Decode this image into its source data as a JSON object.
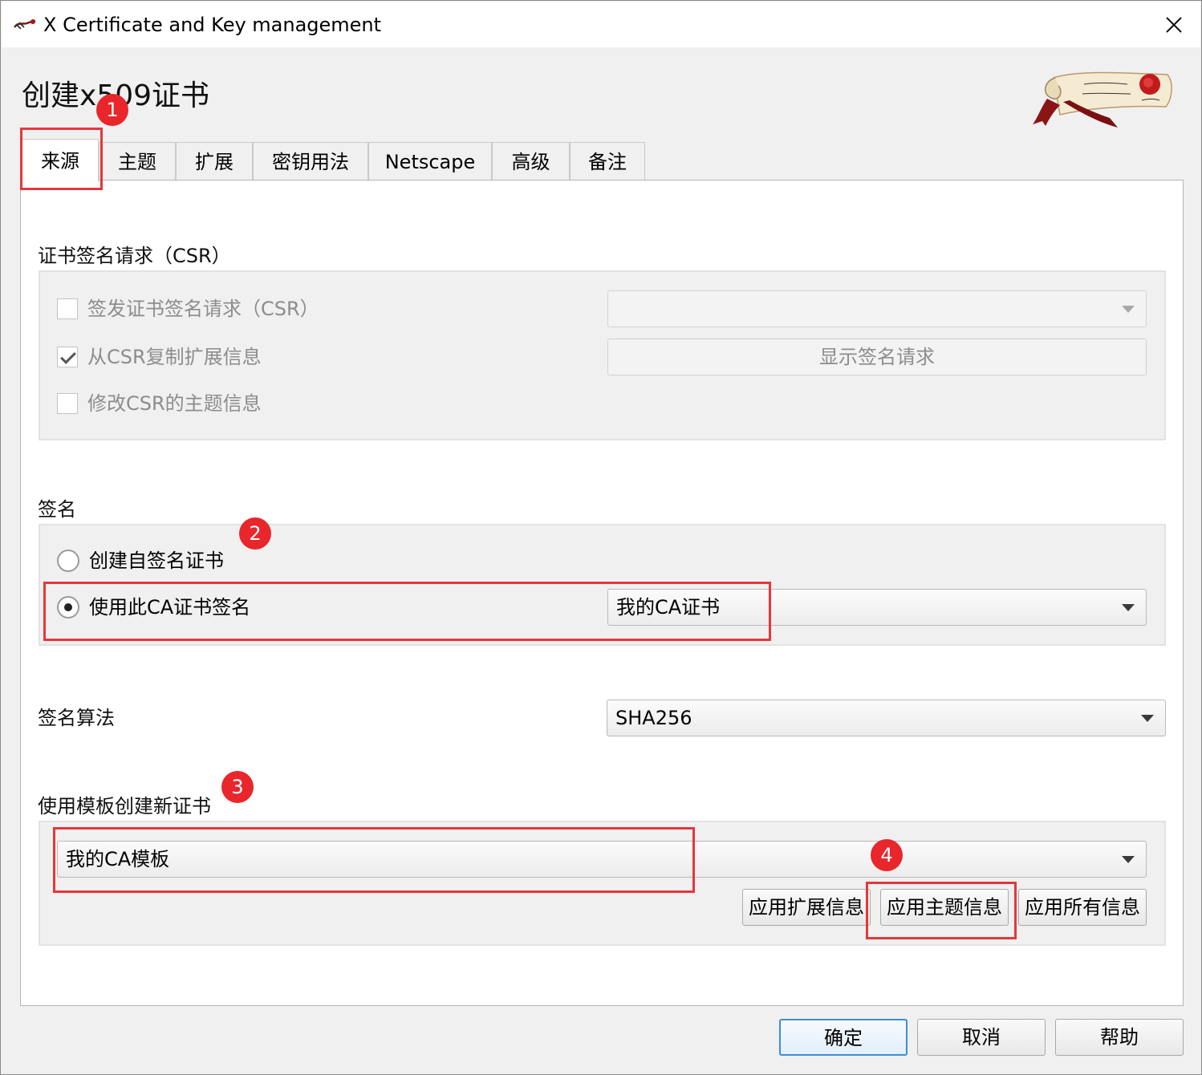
{
  "window": {
    "title": "X Certificate and Key management",
    "icon": "xca-icon",
    "close_icon": "close-icon"
  },
  "page": {
    "title": "创建x509证书",
    "logo": "scroll-rose-logo"
  },
  "tabs": [
    {
      "label": "来源",
      "active": true
    },
    {
      "label": "主题",
      "active": false
    },
    {
      "label": "扩展",
      "active": false
    },
    {
      "label": "密钥用法",
      "active": false
    },
    {
      "label": "Netscape",
      "active": false
    },
    {
      "label": "高级",
      "active": false
    },
    {
      "label": "备注",
      "active": false
    }
  ],
  "csr": {
    "label": "证书签名请求（CSR）",
    "sign_csr": {
      "label": "签发证书签名请求（CSR）",
      "checked": false,
      "enabled": false
    },
    "copy_ext": {
      "label": "从CSR复制扩展信息",
      "checked": true,
      "enabled": false
    },
    "modify_subject": {
      "label": "修改CSR的主题信息",
      "checked": false,
      "enabled": false
    },
    "csr_select_value": "",
    "show_request_button": "显示签名请求"
  },
  "signing": {
    "label": "签名",
    "self_signed": {
      "label": "创建自签名证书",
      "selected": false
    },
    "use_ca": {
      "label": "使用此CA证书签名",
      "selected": true
    },
    "ca_select_value": "我的CA证书"
  },
  "algorithm": {
    "label": "签名算法",
    "value": "SHA256"
  },
  "template": {
    "label": "使用模板创建新证书",
    "value": "我的CA模板",
    "apply_ext_button": "应用扩展信息",
    "apply_subject_button": "应用主题信息",
    "apply_all_button": "应用所有信息"
  },
  "footer": {
    "ok_button": "确定",
    "cancel_button": "取消",
    "help_button": "帮助"
  },
  "annotations": {
    "marker_1": "1",
    "marker_2": "2",
    "marker_3": "3",
    "marker_4": "4",
    "color": "#e5373b"
  }
}
